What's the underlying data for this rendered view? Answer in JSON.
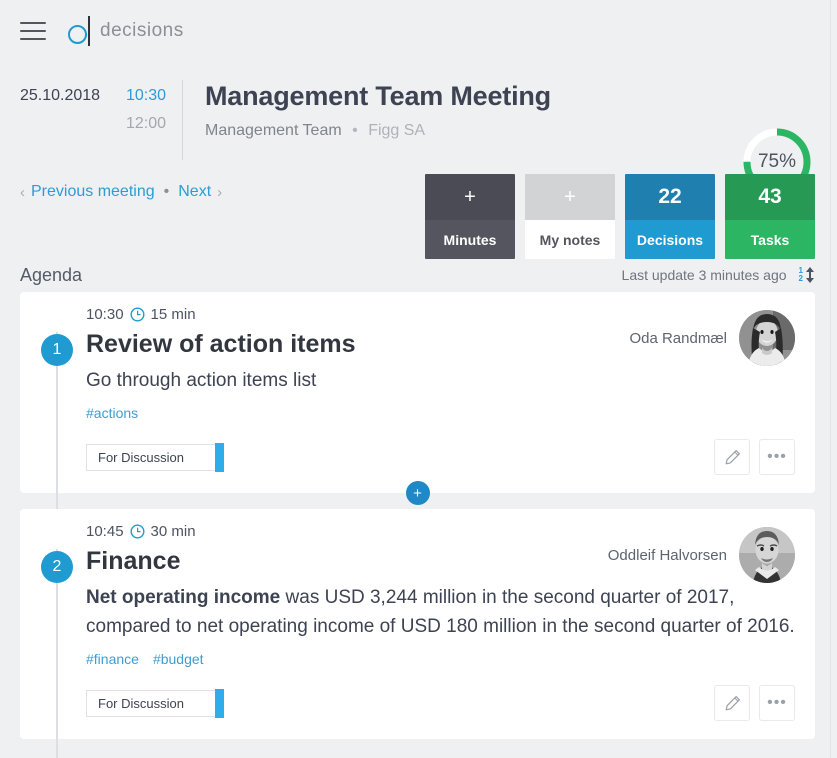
{
  "app": {
    "logo_text": "decisions",
    "menu_icon": "hamburger-icon"
  },
  "meeting": {
    "date": "25.10.2018",
    "time_start": "10:30",
    "time_end": "12:00",
    "title": "Management Team Meeting",
    "team": "Management Team",
    "separator": "•",
    "organization": "Figg SA",
    "progress_percent": "75%",
    "progress_value": 75,
    "progress_color": "#2cb563",
    "progress_track_color": "#ffffff"
  },
  "nav": {
    "prev_chevron": "‹",
    "prev_label": "Previous meeting",
    "dot": "•",
    "next_label": "Next",
    "next_chevron": "›"
  },
  "tiles": [
    {
      "key": "minutes",
      "top": "+",
      "label": "Minutes",
      "top_color": "#4b4b55",
      "bottom_color": "#55555f"
    },
    {
      "key": "mynotes",
      "top": "+",
      "label": "My notes",
      "top_color": "#d2d3d5",
      "bottom_color": "#ffffff"
    },
    {
      "key": "decisions",
      "top": "22",
      "label": "Decisions",
      "top_color": "#1f7fae",
      "bottom_color": "#1f9bd1"
    },
    {
      "key": "tasks",
      "top": "43",
      "label": "Tasks",
      "top_color": "#269a55",
      "bottom_color": "#2cb563"
    }
  ],
  "agenda": {
    "title": "Agenda",
    "last_update": "Last update 3 minutes ago",
    "sort_icon": "sort-order-icon",
    "sort_top_num": "1",
    "sort_bottom_num": "2",
    "add_item_label": "+",
    "items": [
      {
        "number": "1",
        "time": "10:30",
        "clock_icon": "clock-icon",
        "duration": "15 min",
        "title": "Review of action items",
        "description": "Go through action items list",
        "description_bold": "",
        "tags": [
          "#actions"
        ],
        "status": "For Discussion",
        "status_color": "#2fadeb",
        "person": "Oda Randmæl",
        "edit_icon": "pencil-icon",
        "more_icon": "ellipsis-icon"
      },
      {
        "number": "2",
        "time": "10:45",
        "clock_icon": "clock-icon",
        "duration": "30 min",
        "title": "Finance",
        "description_bold": "Net operating income",
        "description": " was USD 3,244 million in the second quarter of 2017, compared to net operating income of USD 180 million in the second quarter of 2016.",
        "tags": [
          "#finance",
          "#budget"
        ],
        "status": "For Discussion",
        "status_color": "#2fadeb",
        "person": "Oddleif Halvorsen",
        "edit_icon": "pencil-icon",
        "more_icon": "ellipsis-icon"
      }
    ]
  },
  "colors": {
    "background": "#eff0f2",
    "accent_blue": "#1f9bd1",
    "link_blue": "#2c9cd4",
    "text_dark": "#3d4352"
  }
}
